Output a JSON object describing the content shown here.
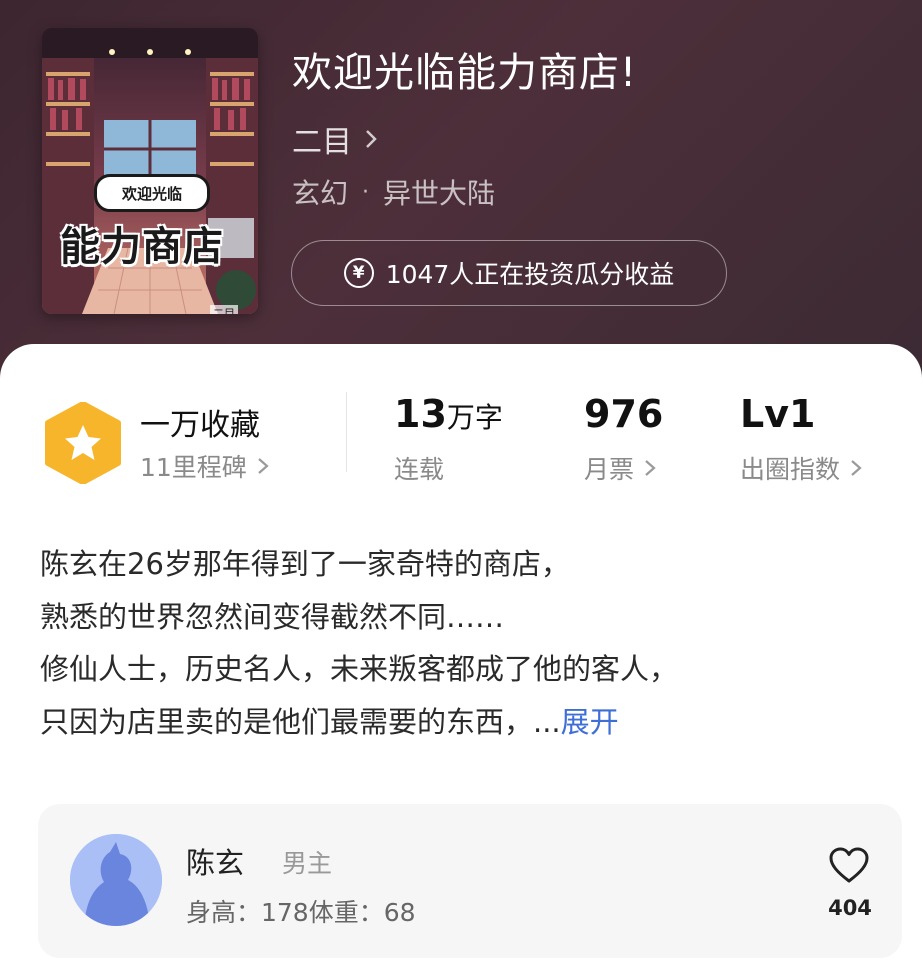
{
  "book": {
    "title": "欢迎光临能力商店!",
    "author": "二目",
    "genre": "玄幻",
    "subgenre": "异世大陆",
    "genre_separator": "·",
    "investors": "1047人正在投资瓜分收益",
    "cover": {
      "bubble_text": "欢迎光临",
      "title_text": "能力商店",
      "author_text": "二目"
    }
  },
  "stats": {
    "collection": {
      "title": "一万收藏",
      "sub": "11里程碑"
    },
    "words": {
      "value": "13",
      "unit": "万字",
      "label": "连载"
    },
    "tickets": {
      "value": "976",
      "label": "月票"
    },
    "level": {
      "value": "Lv1",
      "label": "出圈指数"
    }
  },
  "description": {
    "lines": [
      "陈玄在26岁那年得到了一家奇特的商店，",
      "熟悉的世界忽然间变得截然不同……",
      "修仙人士，历史名人，未来叛客都成了他的客人，",
      "只因为店里卖的是他们最需要的东西，..."
    ],
    "expand": "展开"
  },
  "character": {
    "name": "陈玄",
    "role": "男主",
    "stats": "身高：178体重：68",
    "likes": "404"
  },
  "colors": {
    "hero_bg": "#4a2d38",
    "badge": "#f7b52c",
    "expand_link": "#3f6fd6",
    "avatar": "#9fb6f4"
  }
}
